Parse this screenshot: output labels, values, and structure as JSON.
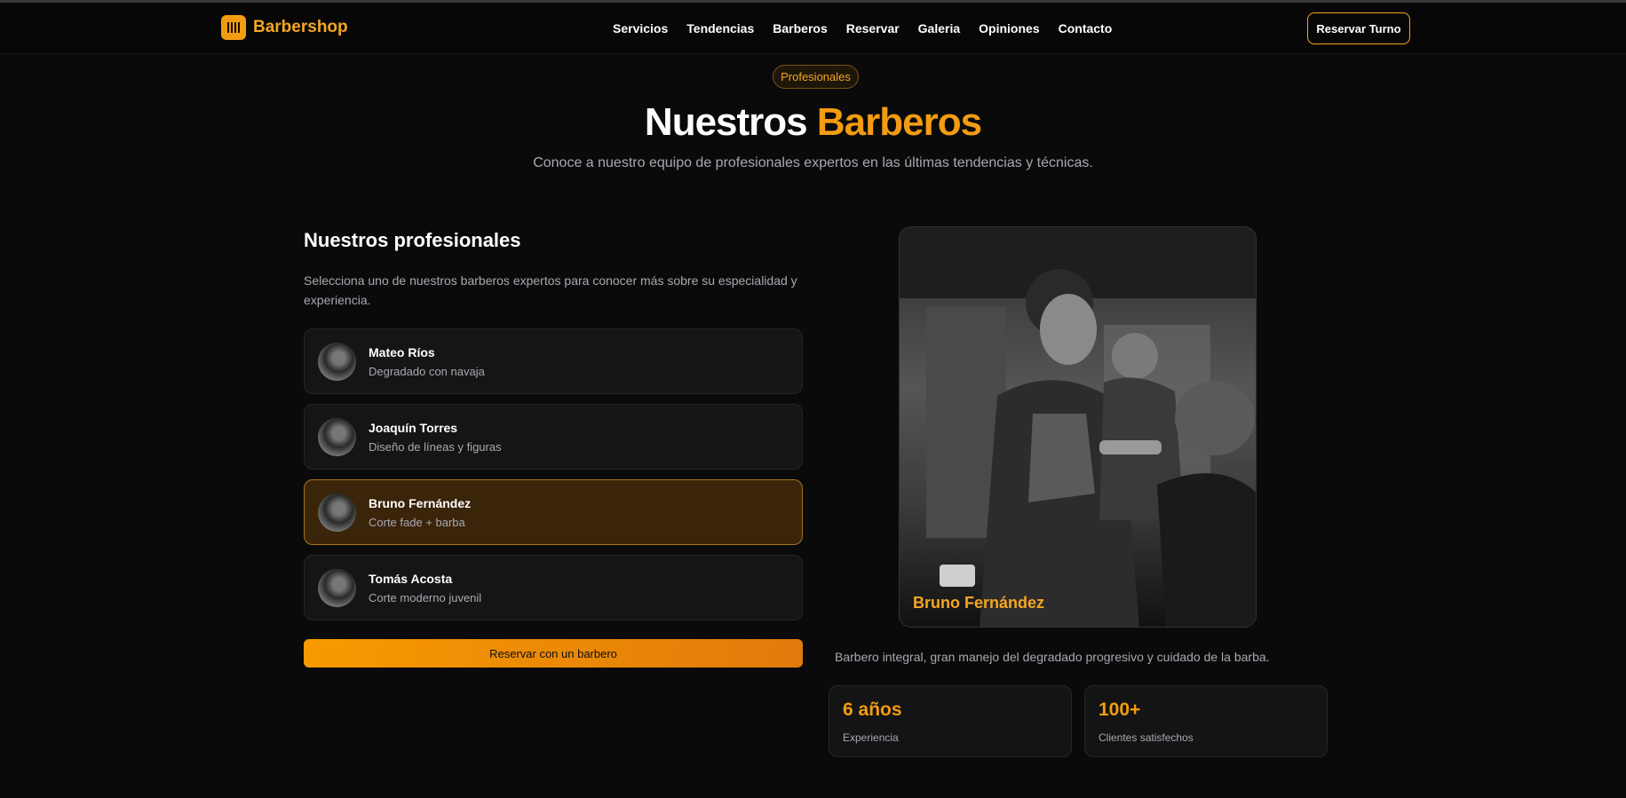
{
  "brand": {
    "name": "Barbershop",
    "accent": "#f39c12"
  },
  "nav": [
    "Servicios",
    "Tendencias",
    "Barberos",
    "Reservar",
    "Galeria",
    "Opiniones",
    "Contacto"
  ],
  "header_button": "Reservar Turno",
  "section": {
    "badge": "Profesionales",
    "title_main": "Nuestros",
    "title_accent": "Barberos",
    "subtitle": "Conoce a nuestro equipo de profesionales expertos en las últimas tendencias y técnicas."
  },
  "left": {
    "title": "Nuestros profesionales",
    "description": "Selecciona uno de nuestros barberos expertos para conocer más sobre su especialidad y experiencia.",
    "barbers": [
      {
        "name": "Mateo Ríos",
        "specialty": "Degradado con navaja"
      },
      {
        "name": "Joaquín Torres",
        "specialty": "Diseño de líneas y figuras"
      },
      {
        "name": "Bruno Fernández",
        "specialty": "Corte fade + barba"
      },
      {
        "name": "Tomás Acosta",
        "specialty": "Corte moderno juvenil"
      }
    ],
    "selected_index": 2,
    "cta": "Reservar con un barbero"
  },
  "detail": {
    "name": "Bruno Fernández",
    "bio": "Barbero integral, gran manejo del degradado progresivo y cuidado de la barba.",
    "stats": [
      {
        "value": "6 años",
        "label": "Experiencia"
      },
      {
        "value": "100+",
        "label": "Clientes satisfechos"
      }
    ]
  }
}
